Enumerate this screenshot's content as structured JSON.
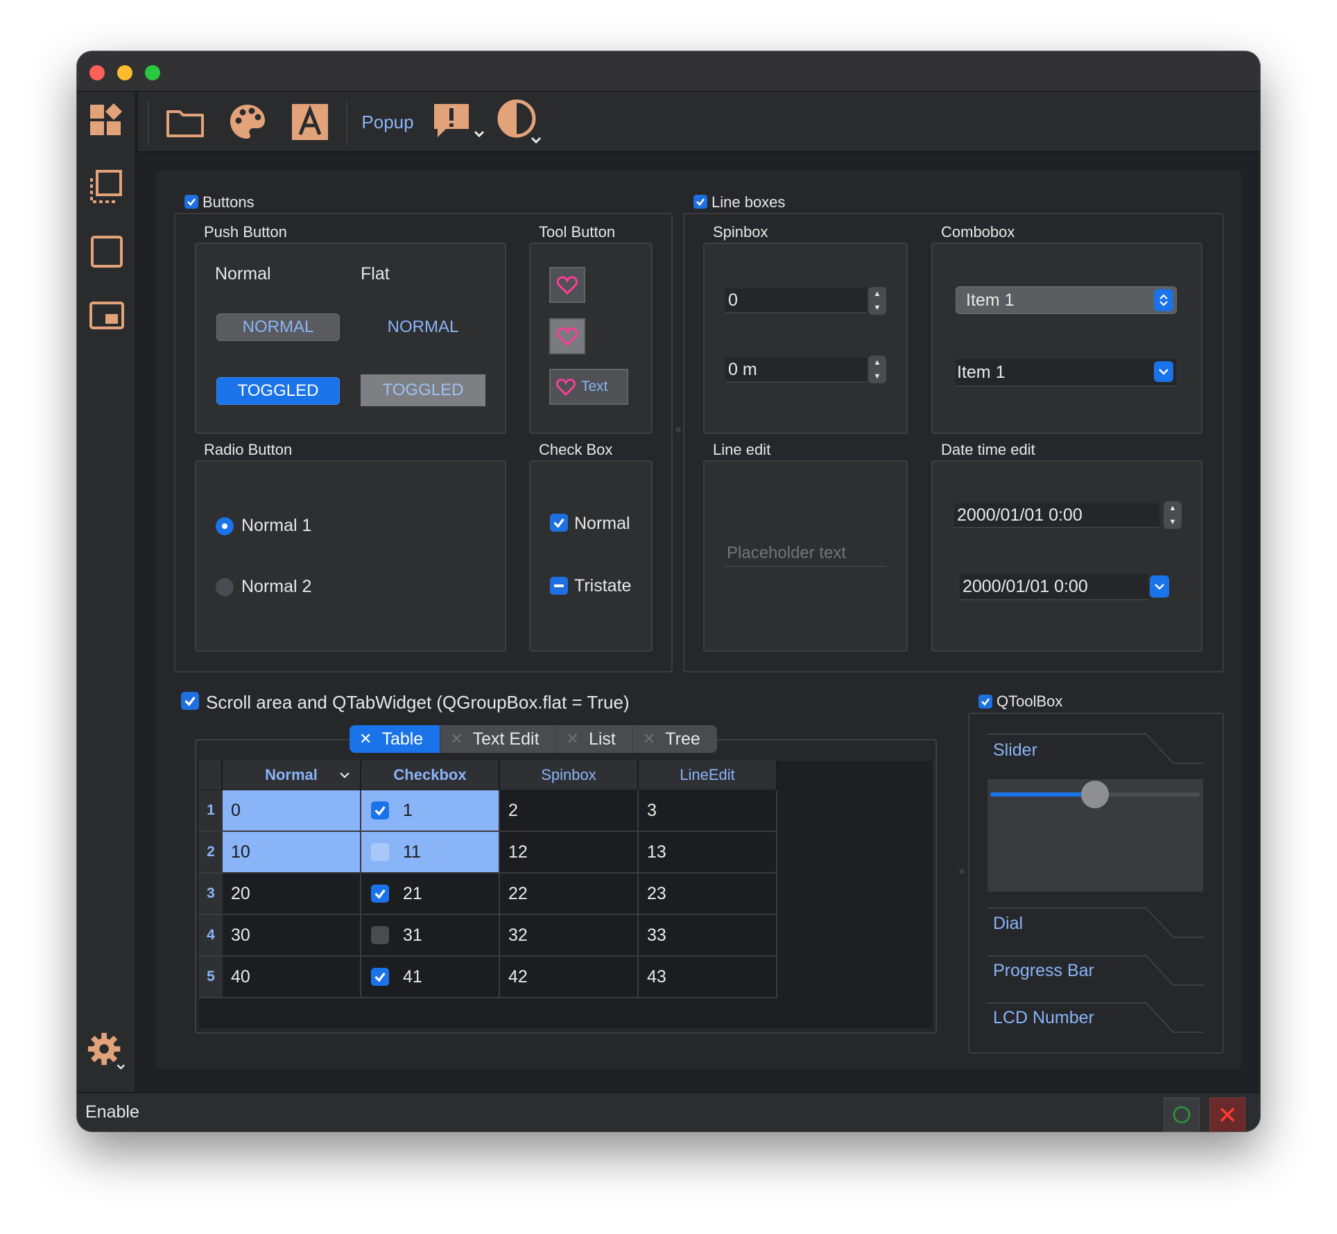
{
  "toolbar": {
    "popup_label": "Popup"
  },
  "buttons_group": {
    "title": "Buttons",
    "push_button": {
      "title": "Push Button",
      "col_normal": "Normal",
      "col_flat": "Flat",
      "normal_label": "NORMAL",
      "flat_label": "NORMAL",
      "toggled_label": "TOGGLED",
      "toggled_flat_label": "TOGGLED"
    },
    "tool_button": {
      "title": "Tool Button",
      "text_label": "Text"
    },
    "radio_button": {
      "title": "Radio Button",
      "option1": "Normal 1",
      "option2": "Normal 2"
    },
    "check_box": {
      "title": "Check Box",
      "normal": "Normal",
      "tristate": "Tristate"
    }
  },
  "line_boxes_group": {
    "title": "Line boxes",
    "spinbox": {
      "title": "Spinbox",
      "value1": "0",
      "value2": "0 m"
    },
    "combobox": {
      "title": "Combobox",
      "value1": "Item 1",
      "value2": "Item 1"
    },
    "line_edit": {
      "title": "Line edit",
      "placeholder": "Placeholder text"
    },
    "datetime_edit": {
      "title": "Date time edit",
      "value1": "2000/01/01 0:00",
      "value2": "2000/01/01 0:00"
    }
  },
  "scroll_group": {
    "title": "Scroll area and QTabWidget (QGroupBox.flat = True)",
    "tabs": [
      "Table",
      "Text Edit",
      "List",
      "Tree"
    ],
    "table": {
      "headers": [
        "Normal",
        "Checkbox",
        "Spinbox",
        "LineEdit"
      ],
      "row_headers": [
        "1",
        "2",
        "3",
        "4",
        "5"
      ],
      "rows": [
        [
          "0",
          "1",
          "2",
          "3"
        ],
        [
          "10",
          "11",
          "12",
          "13"
        ],
        [
          "20",
          "21",
          "22",
          "23"
        ],
        [
          "30",
          "31",
          "32",
          "33"
        ],
        [
          "40",
          "41",
          "42",
          "43"
        ]
      ]
    }
  },
  "toolbox_group": {
    "title": "QToolBox",
    "items": [
      "Slider",
      "Dial",
      "Progress Bar",
      "LCD Number"
    ],
    "slider_value": 0.5
  },
  "statusbar": {
    "text": "Enable"
  },
  "colors": {
    "accent": "#1a73e8",
    "icon": "#e3a37a",
    "link": "#8ab4f8",
    "window_bg": "#202124"
  }
}
